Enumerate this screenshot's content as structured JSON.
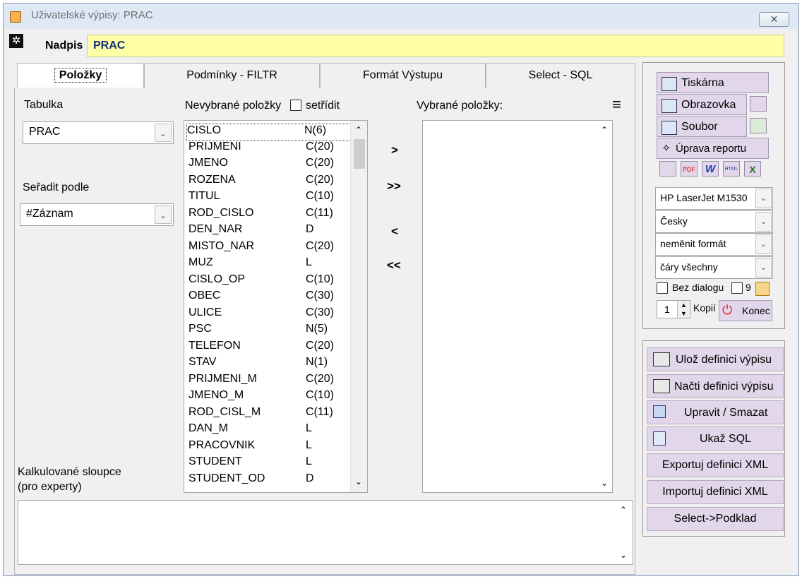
{
  "window": {
    "title": "Uživatelské výpisy: PRAC",
    "close_label": "✕"
  },
  "header": {
    "nadpis_label": "Nadpis",
    "nadpis_value": "PRAC"
  },
  "tabs": [
    {
      "label": "Položky"
    },
    {
      "label": "Podmínky - FILTR"
    },
    {
      "label": "Formát Výstupu"
    },
    {
      "label": "Select - SQL"
    }
  ],
  "left": {
    "tabulka_label": "Tabulka",
    "tabulka_value": "PRAC",
    "seradit_label": "Seřadit podle",
    "seradit_value": "#Záznam",
    "kalk_label_1": "Kalkulované sloupce",
    "kalk_label_2": "(pro experty)"
  },
  "unselected": {
    "label": "Nevybrané položky",
    "sort_label": "setřídit",
    "items": [
      {
        "name": "CISLO",
        "type": "N(6)"
      },
      {
        "name": "PRIJMENI",
        "type": "C(20)"
      },
      {
        "name": "JMENO",
        "type": "C(20)"
      },
      {
        "name": "ROZENA",
        "type": "C(20)"
      },
      {
        "name": "TITUL",
        "type": "C(10)"
      },
      {
        "name": "ROD_CISLO",
        "type": "C(11)"
      },
      {
        "name": "DEN_NAR",
        "type": "D"
      },
      {
        "name": "MISTO_NAR",
        "type": "C(20)"
      },
      {
        "name": "MUZ",
        "type": "L"
      },
      {
        "name": "CISLO_OP",
        "type": "C(10)"
      },
      {
        "name": "OBEC",
        "type": "C(30)"
      },
      {
        "name": "ULICE",
        "type": "C(30)"
      },
      {
        "name": "PSC",
        "type": "N(5)"
      },
      {
        "name": "TELEFON",
        "type": "C(20)"
      },
      {
        "name": "STAV",
        "type": "N(1)"
      },
      {
        "name": "PRIJMENI_M",
        "type": "C(20)"
      },
      {
        "name": "JMENO_M",
        "type": "C(10)"
      },
      {
        "name": "ROD_CISL_M",
        "type": "C(11)"
      },
      {
        "name": "DAN_M",
        "type": "L"
      },
      {
        "name": "PRACOVNIK",
        "type": "L"
      },
      {
        "name": "STUDENT",
        "type": "L"
      },
      {
        "name": "STUDENT_OD",
        "type": "D"
      }
    ]
  },
  "move_buttons": {
    "add": ">",
    "add_all": ">>",
    "remove": "<",
    "remove_all": "<<"
  },
  "selected": {
    "label": "Vybrané položky:"
  },
  "output": {
    "printer": "Tiskárna",
    "screen": "Obrazovka",
    "file": "Soubor",
    "edit_report": "Úprava reportu",
    "format_icons": [
      "table",
      "PDF",
      "W",
      "HTML",
      "X"
    ]
  },
  "settings": {
    "printer_name": "HP LaserJet M1530",
    "language": "Česky",
    "format": "neměnit formát",
    "lines": "čáry všechny",
    "bez_dialogu": "Bez dialogu",
    "num": "9",
    "copies_value": "1",
    "copies_label": "Kopií",
    "konec": "Konec"
  },
  "actions": {
    "save": "Ulož definici výpisu",
    "load": "Načti definici výpisu",
    "edit": "Upravit / Smazat",
    "sql": "Ukaž SQL",
    "export": "Exportuj definici XML",
    "import": "Importuj definici XML",
    "select": "Select->Podklad"
  }
}
